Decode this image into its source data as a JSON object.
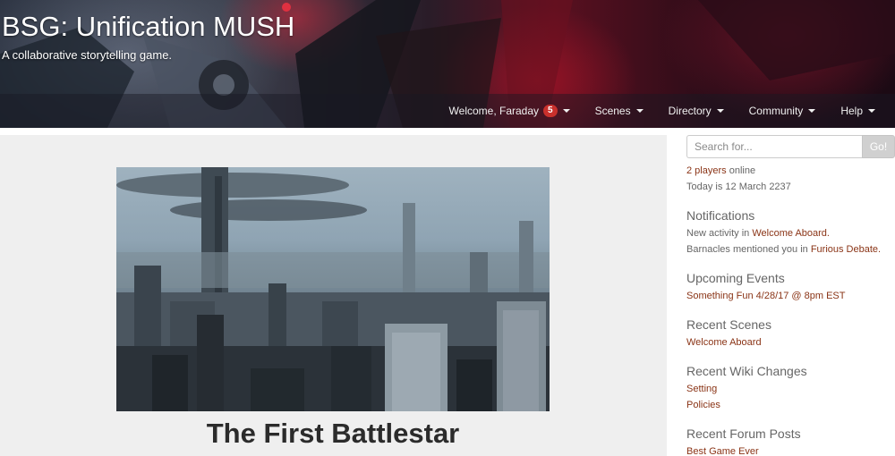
{
  "site": {
    "title": "BSG: Unification MUSH",
    "tagline": "A collaborative storytelling game."
  },
  "nav": {
    "welcome_label": "Welcome, Faraday",
    "welcome_badge": "5",
    "items": [
      {
        "label": "Scenes"
      },
      {
        "label": "Directory"
      },
      {
        "label": "Community"
      },
      {
        "label": "Help"
      }
    ]
  },
  "main": {
    "hero_title": "The First Battlestar"
  },
  "sidebar": {
    "search": {
      "placeholder": "Search for...",
      "button_label": "Go!"
    },
    "online": {
      "count_link": "2 players",
      "suffix": "online"
    },
    "date_text": "Today is 12 March 2237",
    "notifications": {
      "heading": "Notifications",
      "items": [
        {
          "prefix": "New activity in",
          "link": "Welcome Aboard."
        },
        {
          "prefix": "Barnacles mentioned you in",
          "link": "Furious Debate."
        }
      ]
    },
    "upcoming_events": {
      "heading": "Upcoming Events",
      "items": [
        "Something Fun 4/28/17 @ 8pm EST"
      ]
    },
    "recent_scenes": {
      "heading": "Recent Scenes",
      "items": [
        "Welcome Aboard"
      ]
    },
    "recent_wiki": {
      "heading": "Recent Wiki Changes",
      "items": [
        "Setting",
        "Policies"
      ]
    },
    "recent_forum": {
      "heading": "Recent Forum Posts",
      "items": [
        "Best Game Ever"
      ]
    }
  },
  "colors": {
    "link": "#8a3416",
    "badge": "#c9302c",
    "main_panel_bg": "#efefef",
    "hero_title": "#2b2b2b"
  }
}
